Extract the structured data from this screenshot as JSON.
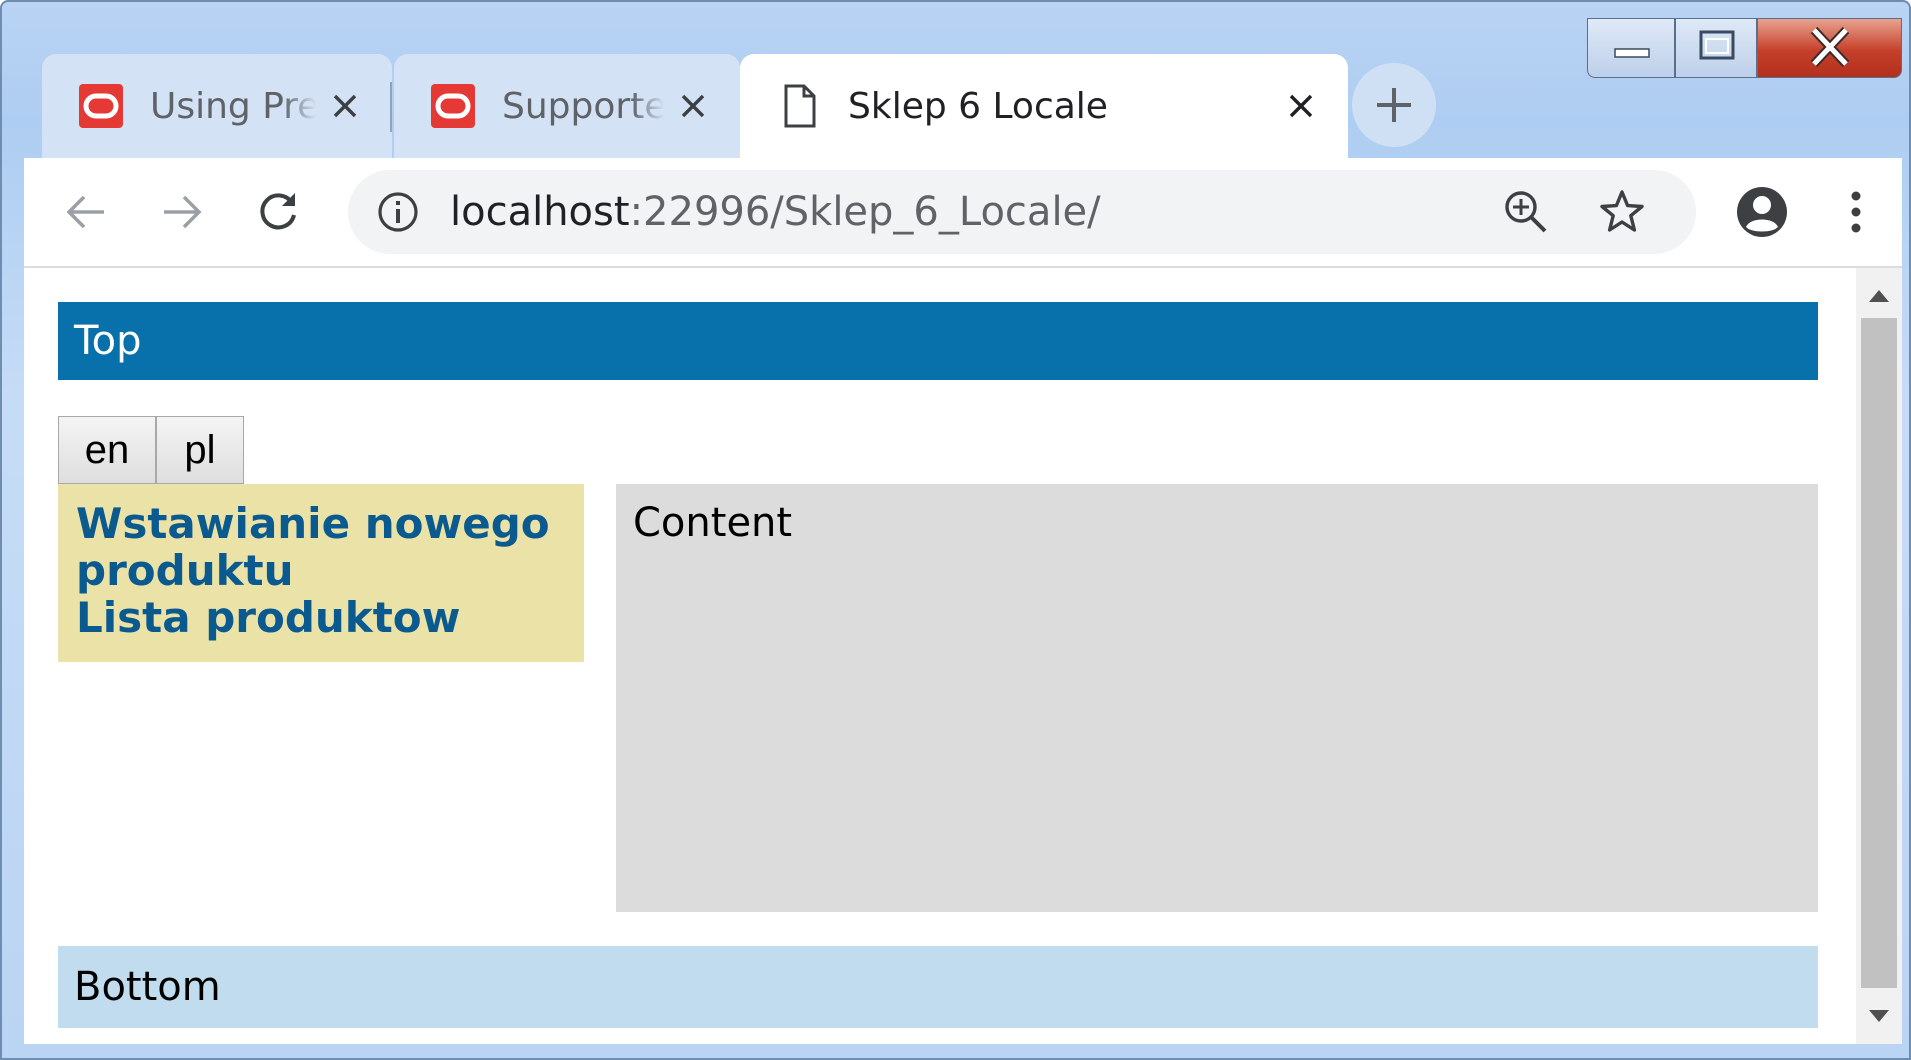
{
  "browser": {
    "tabs": [
      {
        "title": "Using Predefin",
        "favicon": "oracle-icon",
        "active": false
      },
      {
        "title": "Supported Enc",
        "favicon": "oracle-icon",
        "active": false
      },
      {
        "title": "Sklep 6 Locale",
        "favicon": "document-icon",
        "active": true
      }
    ],
    "url_host": "localhost",
    "url_rest": ":22996/Sklep_6_Locale/",
    "accent_colors": {
      "oracle": "#e63946",
      "frame": "#b9d3f3"
    }
  },
  "page": {
    "top": "Top",
    "languages": [
      "en",
      "pl"
    ],
    "menu": [
      "Wstawianie nowego produktu",
      "Lista produktow"
    ],
    "content": "Content",
    "bottom": "Bottom",
    "colors": {
      "top": "#0870aa",
      "menu": "#ebe2a8",
      "link": "#0b5a8f",
      "content": "#dcdcdc",
      "bottom": "#c1dcef"
    }
  }
}
